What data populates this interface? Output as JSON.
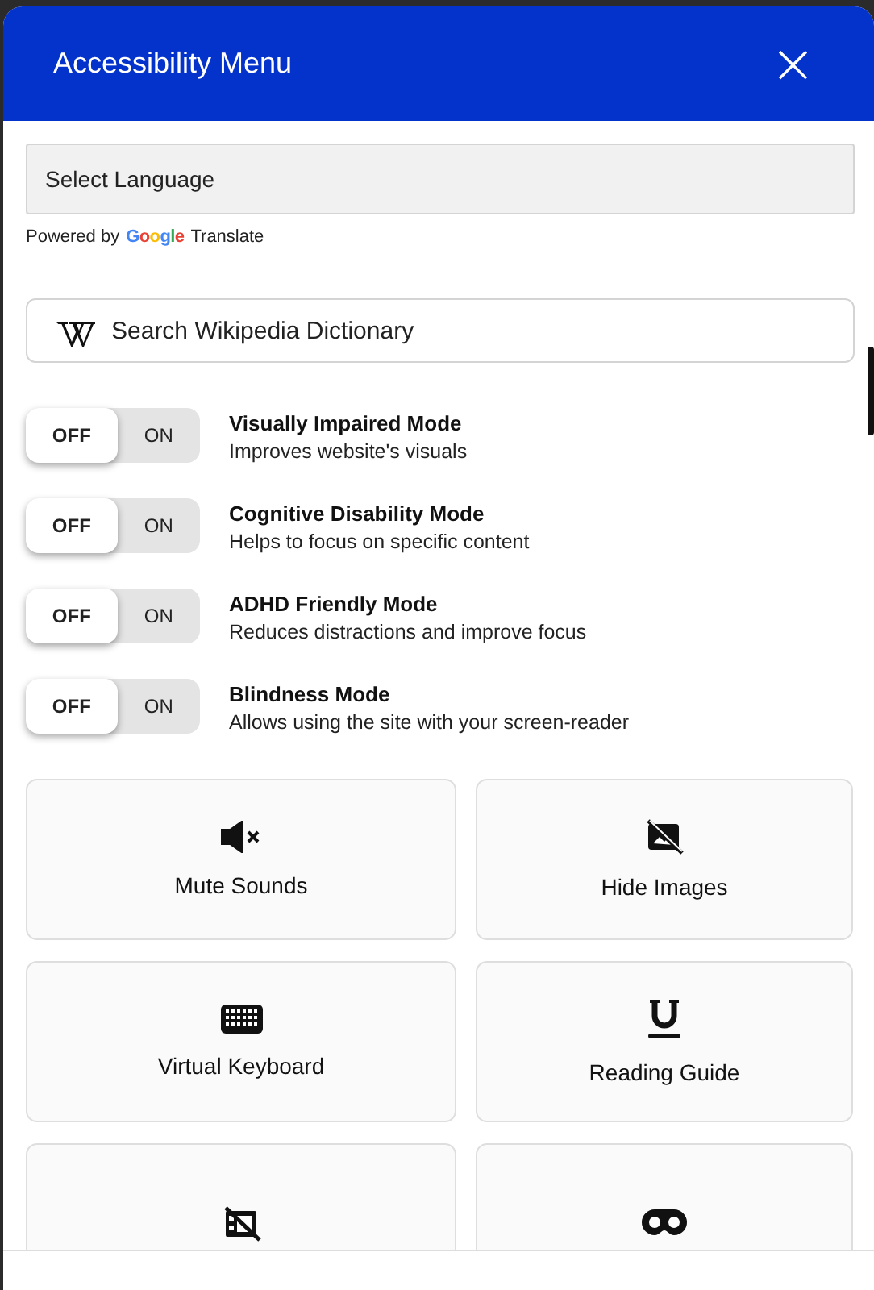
{
  "header": {
    "title": "Accessibility Menu",
    "close": "×"
  },
  "language": {
    "placeholder": "Select Language",
    "powered_by": "Powered by",
    "google": "Google",
    "translate": "Translate"
  },
  "search": {
    "placeholder": "Search Wikipedia Dictionary"
  },
  "modes": [
    {
      "title": "Visually Impaired Mode",
      "description": "Improves website's visuals",
      "off_label": "OFF",
      "on_label": "ON",
      "on": false
    },
    {
      "title": "Cognitive Disability Mode",
      "description": "Helps to focus on specific content",
      "off_label": "OFF",
      "on_label": "ON",
      "on": false
    },
    {
      "title": "ADHD Friendly Mode",
      "description": "Reduces distractions and improve focus",
      "off_label": "OFF",
      "on_label": "ON",
      "on": false
    },
    {
      "title": "Blindness Mode",
      "description": "Allows using the site with your screen-reader",
      "off_label": "OFF",
      "on_label": "ON",
      "on": false
    }
  ],
  "tools": [
    {
      "kind": "mute",
      "label": "Mute Sounds"
    },
    {
      "kind": "hide-images",
      "label": "Hide Images"
    },
    {
      "kind": "keyboard",
      "label": "Virtual Keyboard"
    },
    {
      "kind": "reading-guide",
      "label": "Reading Guide"
    },
    {
      "kind": "hide-video"
    },
    {
      "kind": "mask"
    }
  ]
}
